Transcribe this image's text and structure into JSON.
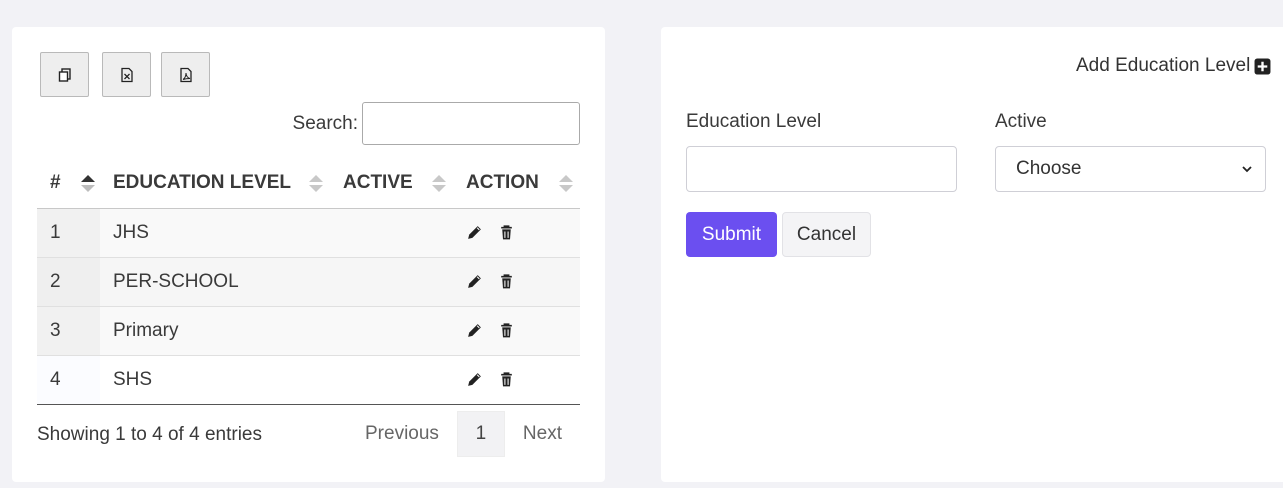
{
  "table_panel": {
    "export_buttons": [
      {
        "icon": "copy-icon"
      },
      {
        "icon": "excel-icon"
      },
      {
        "icon": "pdf-icon"
      }
    ],
    "search_label": "Search:",
    "search_value": "",
    "columns": [
      "#",
      "EDUCATION LEVEL",
      "ACTIVE",
      "ACTION"
    ],
    "rows": [
      {
        "num": "1",
        "level": "JHS",
        "active": ""
      },
      {
        "num": "2",
        "level": "PER-SCHOOL",
        "active": ""
      },
      {
        "num": "3",
        "level": "Primary",
        "active": ""
      },
      {
        "num": "4",
        "level": "SHS",
        "active": ""
      }
    ],
    "info": "Showing 1 to 4 of 4 entries",
    "pager": {
      "previous": "Previous",
      "current": "1",
      "next": "Next"
    }
  },
  "form_panel": {
    "add_link": "Add Education Level",
    "education_level_label": "Education Level",
    "education_level_value": "",
    "active_label": "Active",
    "active_selected": "Choose",
    "submit": "Submit",
    "cancel": "Cancel"
  },
  "colors": {
    "accent": "#6b4ff0",
    "background": "#f2f2f6"
  }
}
